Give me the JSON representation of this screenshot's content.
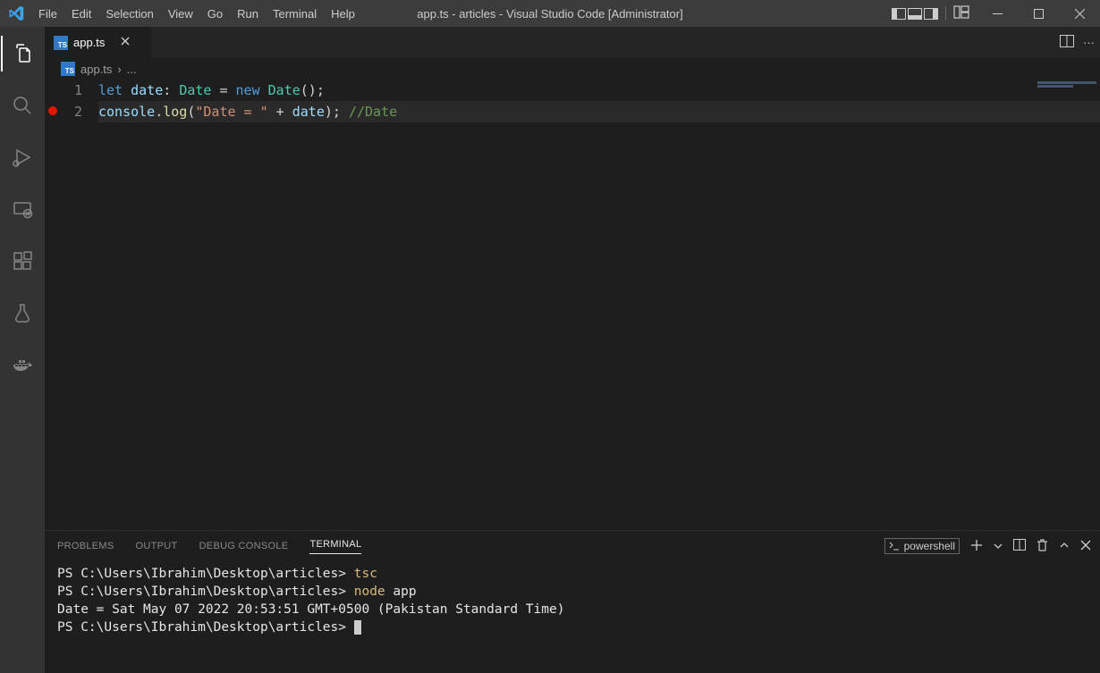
{
  "title": "app.ts - articles - Visual Studio Code [Administrator]",
  "menu": [
    "File",
    "Edit",
    "Selection",
    "View",
    "Go",
    "Run",
    "Terminal",
    "Help"
  ],
  "tab": {
    "icon": "TS",
    "label": "app.ts"
  },
  "breadcrumb": {
    "icon": "TS",
    "file": "app.ts",
    "sep": "›",
    "more": "..."
  },
  "code": {
    "ln1": "1",
    "ln2": "2",
    "let": "let ",
    "var1": "date",
    "colon": ": ",
    "type": "Date",
    "eq": " = ",
    "new": "new ",
    "ctor": "Date",
    "paren": "();",
    "obj": "console",
    "dot": ".",
    "fn": "log",
    "open": "(",
    "str": "\"Date = \"",
    "plus": " + ",
    "var2": "date",
    "close": "); ",
    "cmt": "//Date"
  },
  "panel_tabs": {
    "problems": "PROBLEMS",
    "output": "OUTPUT",
    "debug": "DEBUG CONSOLE",
    "terminal": "TERMINAL"
  },
  "terminal_shell": "powershell",
  "terminal": {
    "p1": "PS C:\\Users\\Ibrahim\\Desktop\\articles> ",
    "c1": "tsc",
    "p2": "PS C:\\Users\\Ibrahim\\Desktop\\articles> ",
    "c2": "node ",
    "c2b": "app",
    "out": "Date = Sat May 07 2022 20:53:51 GMT+0500 (Pakistan Standard Time)",
    "p3": "PS C:\\Users\\Ibrahim\\Desktop\\articles> "
  }
}
